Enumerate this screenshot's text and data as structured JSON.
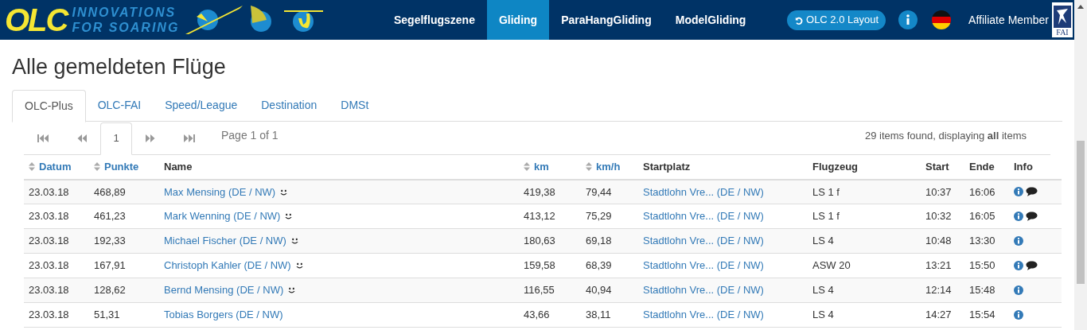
{
  "header": {
    "logo_text": "OLC",
    "tagline": [
      "INNOVATIONS",
      "FOR SOARING"
    ],
    "nav": [
      {
        "label": "Segelflugszene",
        "selected": false
      },
      {
        "label": "Gliding",
        "selected": true
      },
      {
        "label": "ParaHangGliding",
        "selected": false
      },
      {
        "label": "ModelGliding",
        "selected": false
      }
    ],
    "layout_button": "OLC 2.0 Layout",
    "affiliate": "Affiliate Member",
    "fai_label": "FAI"
  },
  "title": "Alle gemeldeten Flüge",
  "tabs": [
    {
      "label": "OLC-Plus",
      "selected": true
    },
    {
      "label": "OLC-FAI",
      "selected": false
    },
    {
      "label": "Speed/League",
      "selected": false
    },
    {
      "label": "Destination",
      "selected": false
    },
    {
      "label": "DMSt",
      "selected": false
    }
  ],
  "pagination": {
    "pages": [
      {
        "label": "1",
        "selected": true
      }
    ],
    "page_info": "Page 1 of 1",
    "summary": "29 items found, displaying **all** items"
  },
  "table": {
    "columns": [
      {
        "label": "Datum",
        "sortable": true
      },
      {
        "label": "Punkte",
        "sortable": true
      },
      {
        "label": "Name",
        "sortable": false
      },
      {
        "label": "km",
        "sortable": true
      },
      {
        "label": "km/h",
        "sortable": true
      },
      {
        "label": "Startplatz",
        "sortable": false
      },
      {
        "label": "Flugzeug",
        "sortable": false
      },
      {
        "label": "Start",
        "sortable": false
      },
      {
        "label": "Ende",
        "sortable": false
      },
      {
        "label": "Info",
        "sortable": false
      }
    ],
    "rows": [
      {
        "date": "23.03.18",
        "points": "468,89",
        "name": "Max Mensing (DE / NW)",
        "smiley": true,
        "km": "419,38",
        "kmh": "79,44",
        "airfield": "Stadtlohn Vre... (DE / NW)",
        "aircraft": "LS 1 f",
        "start": "10:37",
        "end": "16:06",
        "comment": true
      },
      {
        "date": "23.03.18",
        "points": "461,23",
        "name": "Mark Wenning (DE / NW)",
        "smiley": true,
        "km": "413,12",
        "kmh": "75,29",
        "airfield": "Stadtlohn Vre... (DE / NW)",
        "aircraft": "LS 1 f",
        "start": "10:32",
        "end": "16:05",
        "comment": true
      },
      {
        "date": "23.03.18",
        "points": "192,33",
        "name": "Michael Fischer (DE / NW)",
        "smiley": true,
        "km": "180,63",
        "kmh": "69,18",
        "airfield": "Stadtlohn Vre... (DE / NW)",
        "aircraft": "LS 4",
        "start": "10:48",
        "end": "13:30",
        "comment": false
      },
      {
        "date": "23.03.18",
        "points": "167,91",
        "name": "Christoph Kahler (DE / NW)",
        "smiley": true,
        "km": "159,58",
        "kmh": "68,39",
        "airfield": "Stadtlohn Vre... (DE / NW)",
        "aircraft": "ASW 20",
        "start": "13:21",
        "end": "15:50",
        "comment": true
      },
      {
        "date": "23.03.18",
        "points": "128,62",
        "name": "Bernd Mensing (DE / NW)",
        "smiley": true,
        "km": "116,55",
        "kmh": "40,94",
        "airfield": "Stadtlohn Vre... (DE / NW)",
        "aircraft": "LS 4",
        "start": "12:14",
        "end": "15:48",
        "comment": false
      },
      {
        "date": "23.03.18",
        "points": "51,31",
        "name": "Tobias Borgers (DE / NW)",
        "smiley": false,
        "km": "43,66",
        "kmh": "38,11",
        "airfield": "Stadtlohn Vre... (DE / NW)",
        "aircraft": "LS 4",
        "start": "14:27",
        "end": "15:54",
        "comment": false
      }
    ]
  }
}
